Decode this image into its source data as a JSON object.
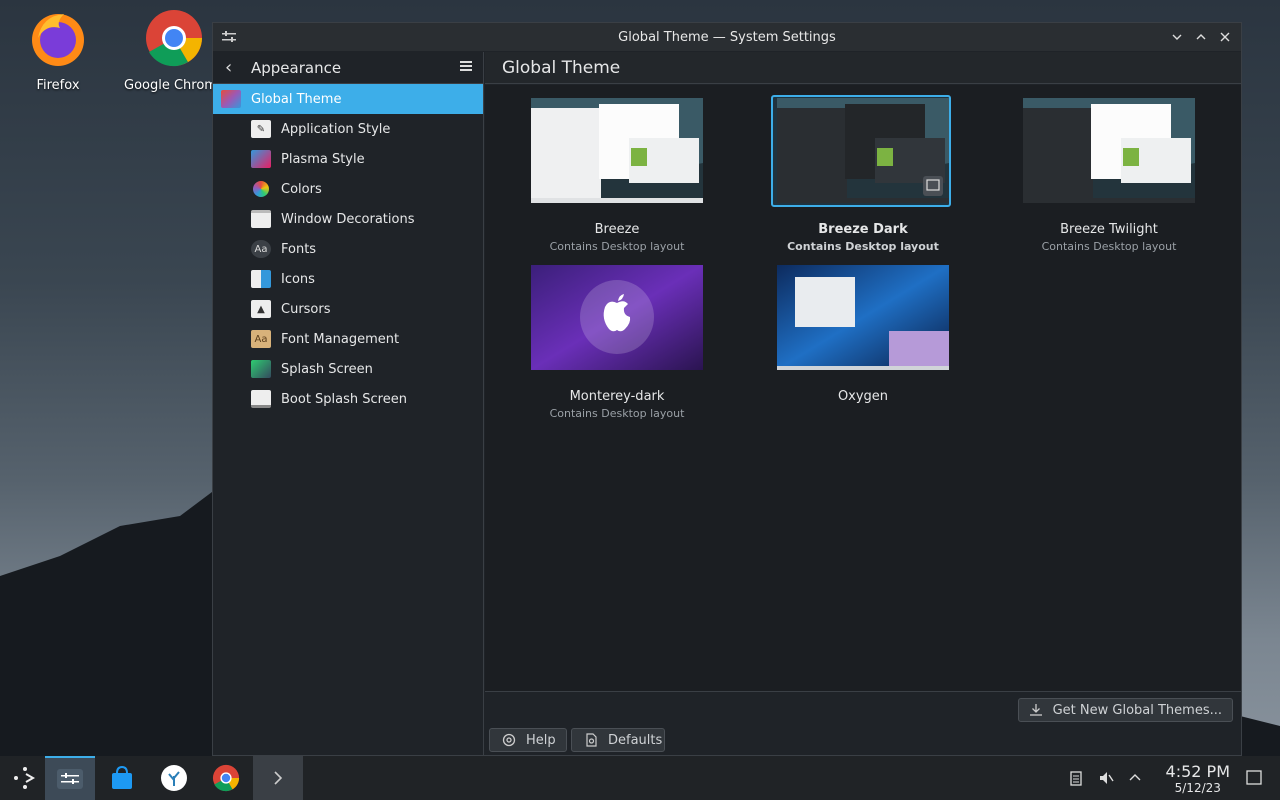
{
  "desktop": {
    "icons": [
      {
        "label": "Firefox",
        "icon": "firefox-icon"
      },
      {
        "label": "Google Chrome",
        "icon": "chrome-icon"
      }
    ]
  },
  "window": {
    "title": "Global Theme — System Settings"
  },
  "sidebar": {
    "header": "Appearance",
    "items": [
      {
        "label": "Global Theme",
        "icon": "global-theme-icon",
        "active": true
      },
      {
        "label": "Application Style",
        "icon": "application-style-icon"
      },
      {
        "label": "Plasma Style",
        "icon": "plasma-style-icon"
      },
      {
        "label": "Colors",
        "icon": "colors-icon"
      },
      {
        "label": "Window Decorations",
        "icon": "window-decorations-icon"
      },
      {
        "label": "Fonts",
        "icon": "fonts-icon"
      },
      {
        "label": "Icons",
        "icon": "icons-icon"
      },
      {
        "label": "Cursors",
        "icon": "cursors-icon"
      },
      {
        "label": "Font Management",
        "icon": "font-management-icon"
      },
      {
        "label": "Splash Screen",
        "icon": "splash-screen-icon"
      },
      {
        "label": "Boot Splash Screen",
        "icon": "boot-splash-screen-icon"
      }
    ]
  },
  "main": {
    "title": "Global Theme",
    "themes": [
      {
        "name": "Breeze",
        "sub": "Contains Desktop layout",
        "selected": false
      },
      {
        "name": "Breeze Dark",
        "sub": "Contains Desktop layout",
        "selected": true
      },
      {
        "name": "Breeze Twilight",
        "sub": "Contains Desktop layout",
        "selected": false
      },
      {
        "name": "Monterey-dark",
        "sub": "Contains Desktop layout",
        "selected": false
      },
      {
        "name": "Oxygen",
        "sub": "",
        "selected": false
      }
    ],
    "get_new_label": "Get New Global Themes...",
    "help_label": "Help",
    "defaults_label": "Defaults"
  },
  "taskbar": {
    "time": "4:52 PM",
    "date": "5/12/23"
  },
  "colors": {
    "accent": "#3daee9",
    "window_bg": "#1f2328",
    "taskbar_bg": "#202326"
  }
}
